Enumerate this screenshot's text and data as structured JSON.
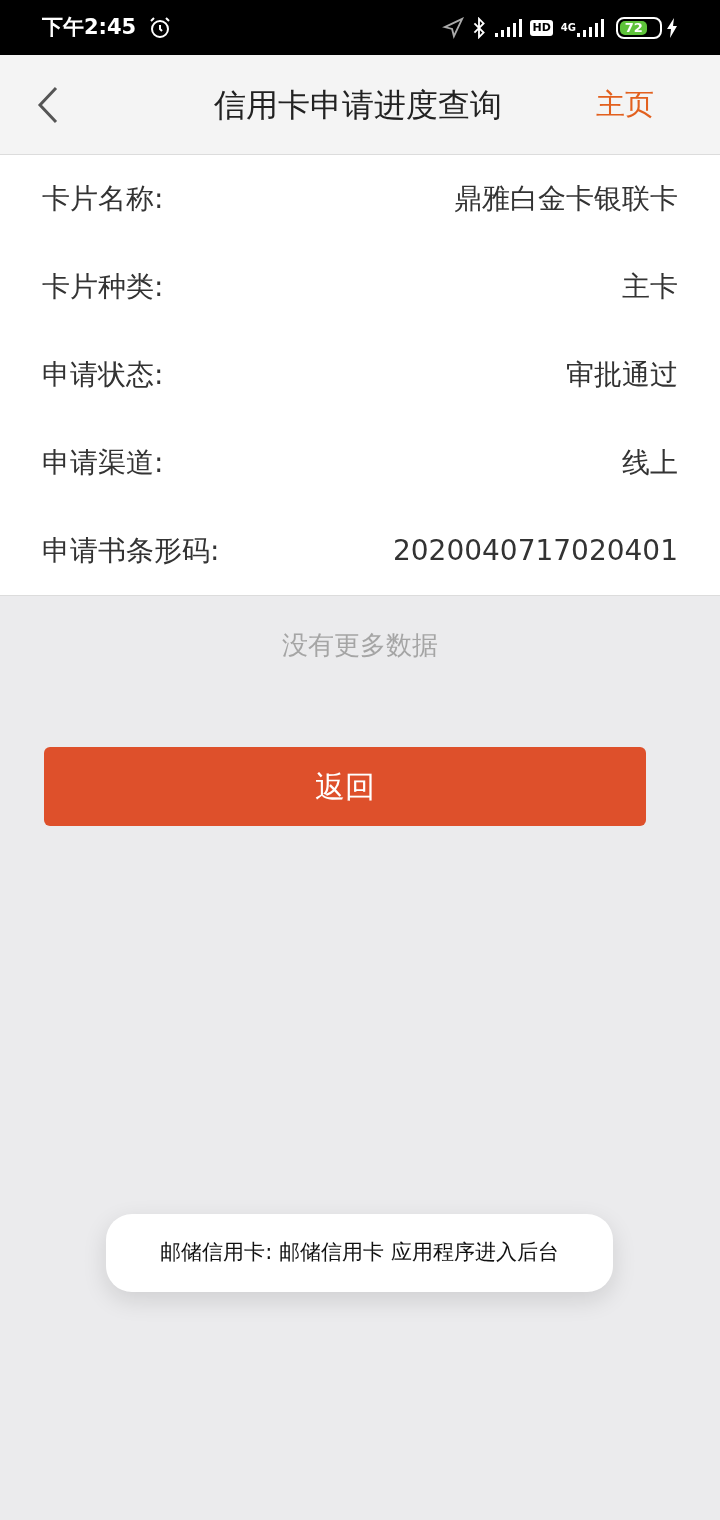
{
  "status_bar": {
    "time": "下午2:45",
    "hd": "HD",
    "network": "4G",
    "battery": "72"
  },
  "header": {
    "title": "信用卡申请进度查询",
    "home_link": "主页"
  },
  "details": [
    {
      "label": "卡片名称:",
      "value": "鼎雅白金卡银联卡"
    },
    {
      "label": "卡片种类:",
      "value": "主卡"
    },
    {
      "label": "申请状态:",
      "value": "审批通过"
    },
    {
      "label": "申请渠道:",
      "value": "线上"
    },
    {
      "label": "申请书条形码:",
      "value": "2020040717020401"
    }
  ],
  "no_more": "没有更多数据",
  "back_button": "返回",
  "toast": "邮储信用卡: 邮储信用卡 应用程序进入后台"
}
